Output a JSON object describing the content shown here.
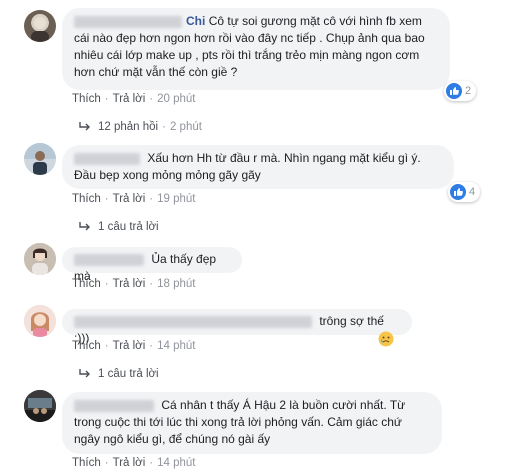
{
  "comments": [
    {
      "name": "Chi",
      "text": "Cô tự soi gương mặt cô với hình fb xem cái nào đẹp hơn ngon hơn rồi vào đây nc tiếp . Chụp ảnh qua bao nhiêu cái lớp make up , pts rồi thì trắng trẻo mịn màng ngon cơm hơn chứ mặt vẫn thế còn giề ?",
      "actions": {
        "like": "Thích",
        "reply": "Trả lời",
        "time": "20 phút"
      },
      "reaction_count": "2",
      "reply_summary": {
        "label": "12 phản hồi",
        "time": "2 phút"
      }
    },
    {
      "text": "Xấu hơn Hh từ đầu r mà. Nhìn ngang mặt kiểu gì ý. Đầu bẹp xong mỏng mỏng gãy gãy",
      "actions": {
        "like": "Thích",
        "reply": "Trả lời",
        "time": "19 phút"
      },
      "reaction_count": "4",
      "reply_summary": {
        "label": "1 câu trả lời"
      }
    },
    {
      "text": "Ủa thấy đẹp mà",
      "actions": {
        "like": "Thích",
        "reply": "Trả lời",
        "time": "18 phút"
      }
    },
    {
      "text": "trông sợ thế :)))",
      "actions": {
        "like": "Thích",
        "reply": "Trả lời",
        "time": "14 phút"
      },
      "reply_summary": {
        "label": "1 câu trả lời"
      }
    },
    {
      "text": "Cá nhân t thấy Á Hậu 2 là buồn cười nhất. Từ trong cuộc thi tới lúc thi xong trả lời phỏng vấn. Cảm giác chứ ngây ngô kiểu gì, để chúng nó gài ấy",
      "actions": {
        "like": "Thích",
        "reply": "Trả lời",
        "time": "14 phút"
      }
    }
  ],
  "colors": {
    "link": "#385898",
    "meta": "#90949c",
    "bubble": "#f2f3f5",
    "like": "#2e7ce4",
    "haha": "#f7c44a"
  }
}
